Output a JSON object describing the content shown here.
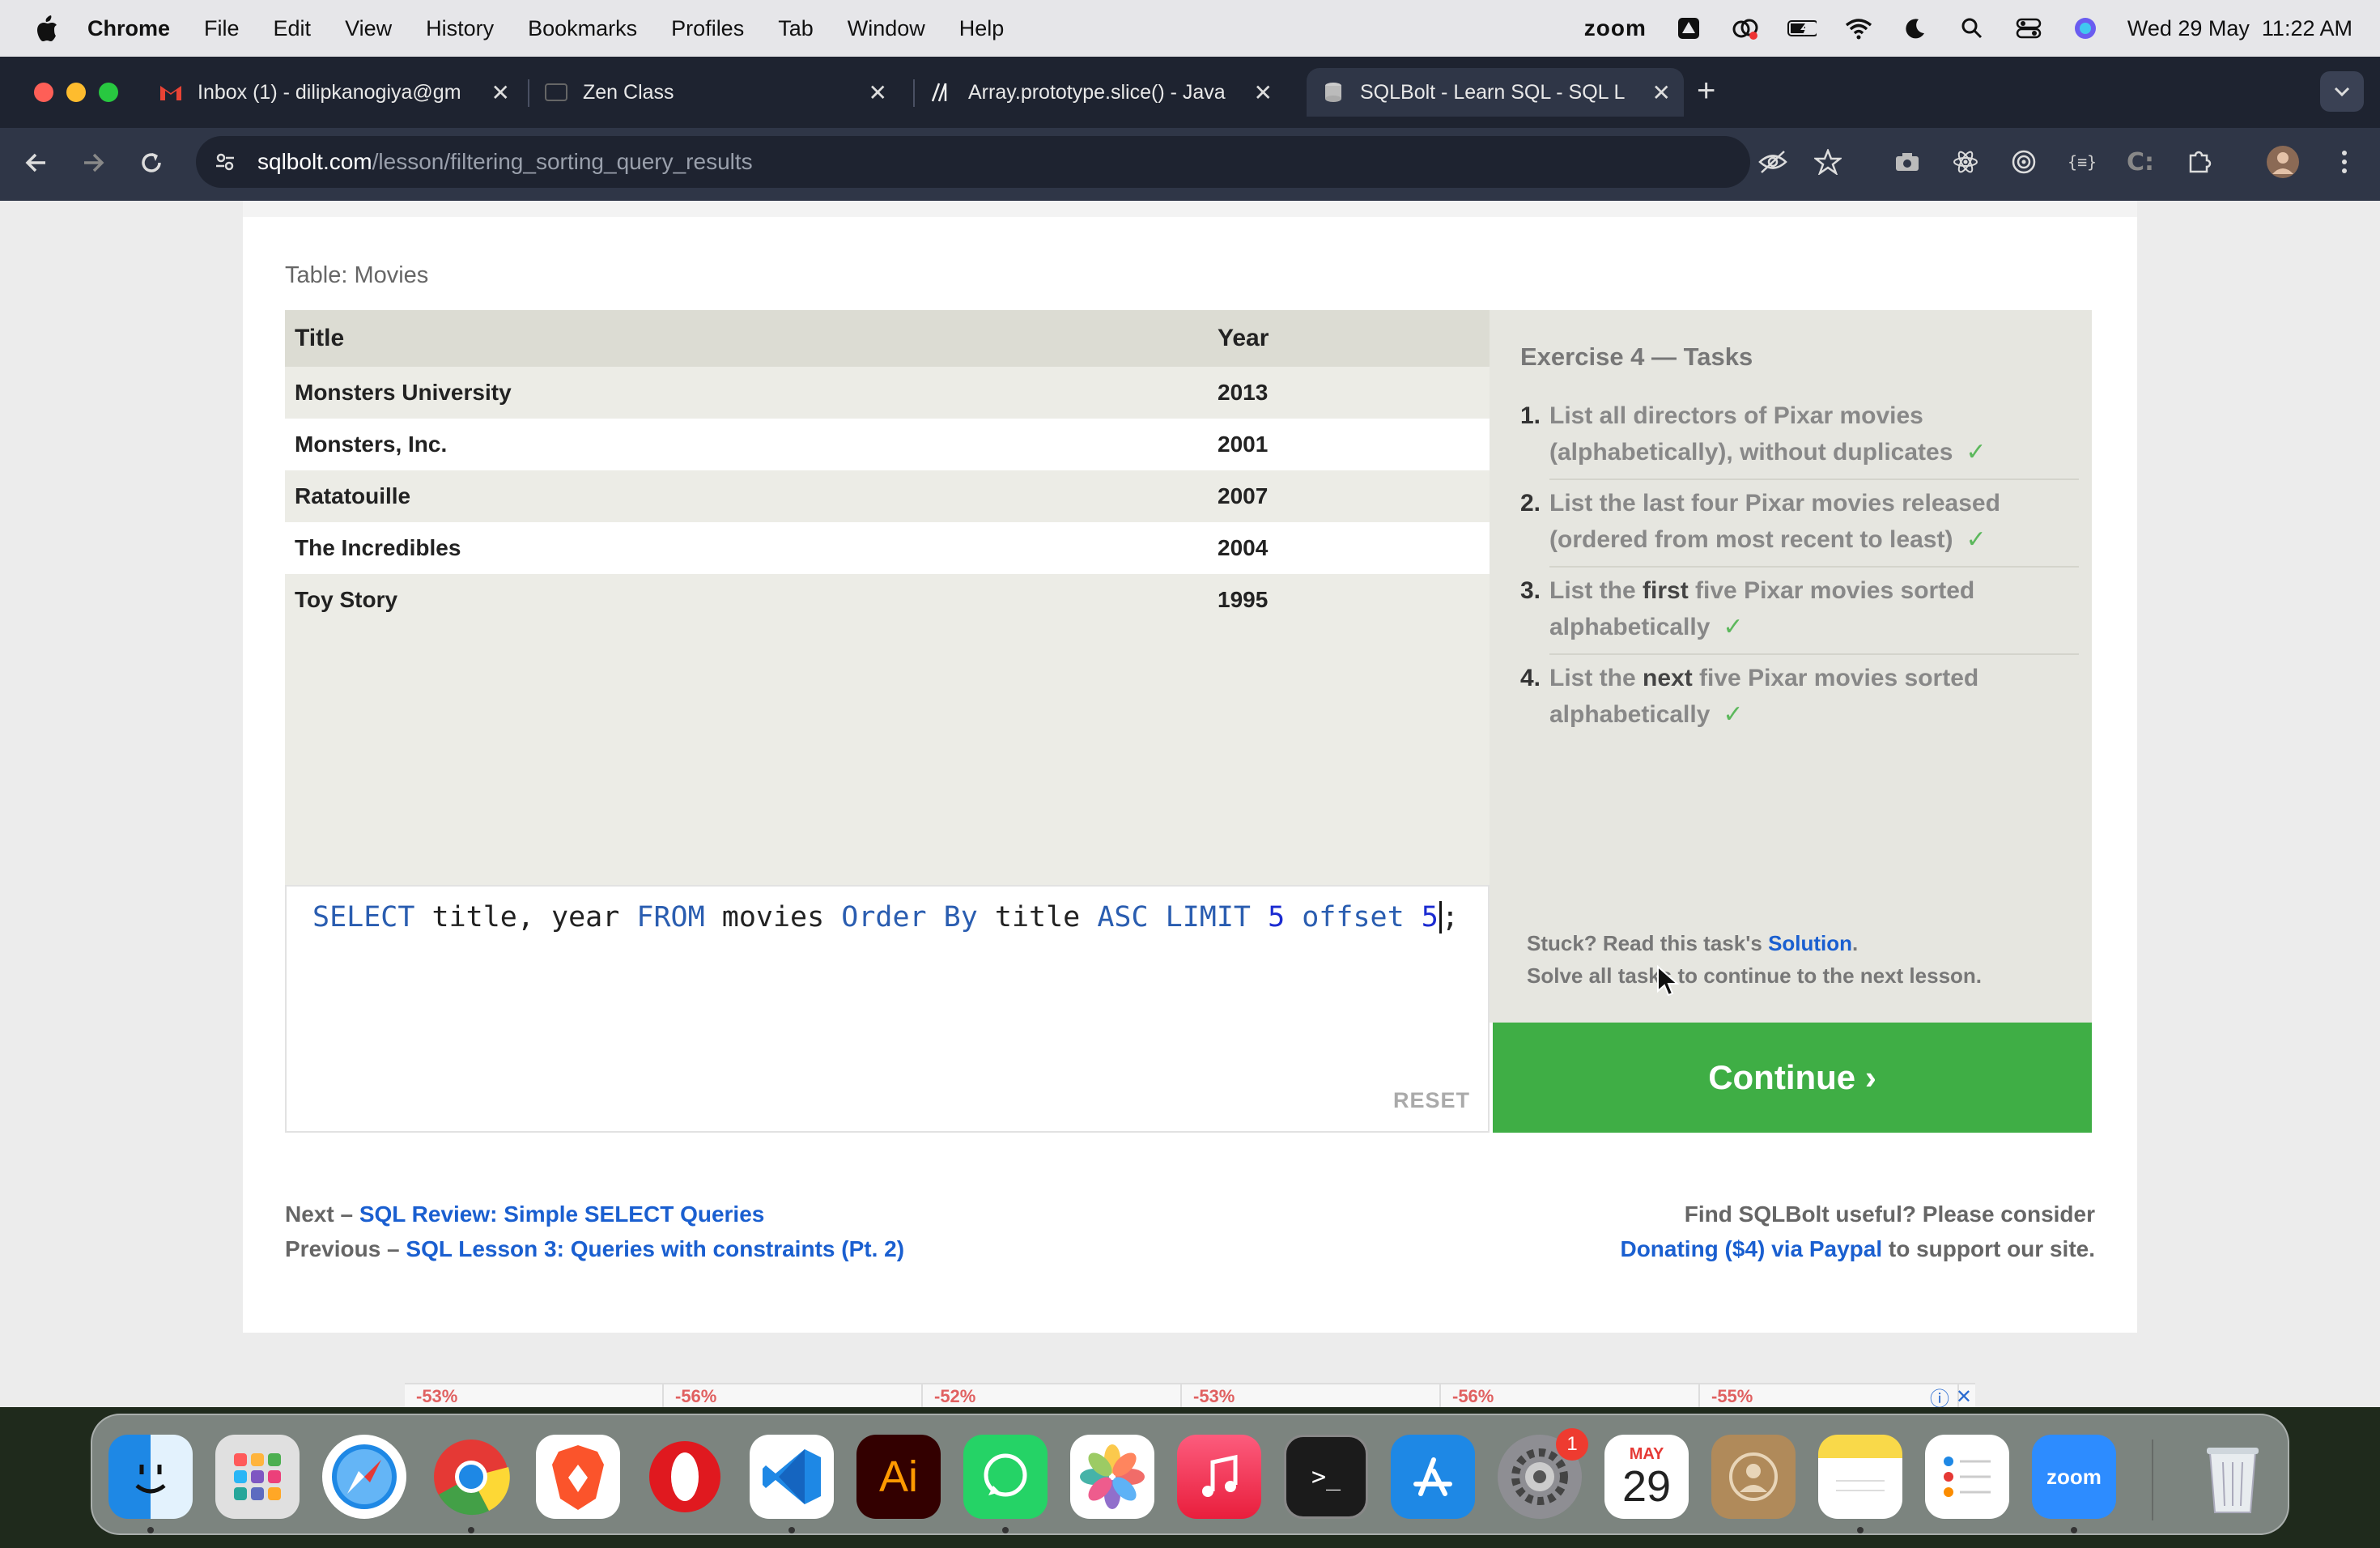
{
  "menubar": {
    "app": "Chrome",
    "menus": [
      "File",
      "Edit",
      "View",
      "History",
      "Bookmarks",
      "Profiles",
      "Tab",
      "Window",
      "Help"
    ],
    "zoom": "zoom",
    "datetime": "Wed 29 May  11:22 AM"
  },
  "tabs": [
    {
      "title": "Inbox (1) - dilipkanogiya@gm",
      "icon": "gmail-icon"
    },
    {
      "title": "Zen Class",
      "icon": "zen-icon"
    },
    {
      "title": "Array.prototype.slice() - Java",
      "icon": "mdn-icon"
    },
    {
      "title": "SQLBolt - Learn SQL - SQL L",
      "icon": "sqlbolt-icon",
      "active": true
    }
  ],
  "address": {
    "host": "sqlbolt.com",
    "path": "/lesson/filtering_sorting_query_results"
  },
  "page": {
    "table_label": "Table: Movies",
    "columns": [
      "Title",
      "Year"
    ],
    "rows": [
      {
        "title": "Monsters University",
        "year": "2013"
      },
      {
        "title": "Monsters, Inc.",
        "year": "2001"
      },
      {
        "title": "Ratatouille",
        "year": "2007"
      },
      {
        "title": "The Incredibles",
        "year": "2004"
      },
      {
        "title": "Toy Story",
        "year": "1995"
      }
    ],
    "query": {
      "t1": "SELECT",
      "t2": " title, year ",
      "t3": "FROM",
      "t4": " movies ",
      "t5": "Order By",
      "t6": " title ",
      "t7": "ASC LIMIT",
      "t8": " ",
      "t9": "5",
      "t10": " ",
      "t11": "offset",
      "t12": " ",
      "t13": "5",
      "t14": ";"
    },
    "reset": "RESET",
    "exercise_heading": "Exercise 4 — Tasks",
    "tasks": [
      {
        "num": "1.",
        "a": "List all directors of Pixar movies (alphabetically), without duplicates",
        "check": "✓"
      },
      {
        "num": "2.",
        "a": "List the last four Pixar movies released (ordered from most recent to least)",
        "check": "✓"
      },
      {
        "num": "3.",
        "pre": "List the ",
        "em": "first",
        "post": " five Pixar movies sorted alphabetically",
        "check": "✓"
      },
      {
        "num": "4.",
        "pre": "List the ",
        "em": "next",
        "post": " five Pixar movies sorted alphabetically",
        "check": "✓"
      }
    ],
    "stuck_prefix": "Stuck? Read this task's ",
    "solution_link": "Solution",
    "stuck_suffix": ".",
    "solve_all": "Solve all tasks to continue to the next lesson.",
    "continue": "Continue ›",
    "next_prefix": "Next – ",
    "next_link": "SQL Review: Simple SELECT Queries",
    "prev_prefix": "Previous – ",
    "prev_link": "SQL Lesson 3: Queries with constraints (Pt. 2)",
    "useful_text": "Find SQLBolt useful? Please consider",
    "donate_link": "Donating ($4) via Paypal",
    "donate_suffix": " to support our site.",
    "ads": [
      "-53%",
      "-56%",
      "-52%",
      "-53%",
      "-56%",
      "-55%"
    ]
  },
  "dock": {
    "apps": [
      "finder-icon",
      "launchpad-icon",
      "safari-icon",
      "chrome-icon",
      "brave-icon",
      "opera-icon",
      "vscode-icon",
      "illustrator-icon",
      "whatsapp-icon",
      "photos-icon",
      "music-icon",
      "terminal-icon",
      "appstore-icon",
      "settings-icon",
      "calendar-icon",
      "contacts-icon",
      "notes-icon",
      "reminders-icon",
      "zoom-icon",
      "trash-icon"
    ],
    "settings_badge": "1",
    "calendar_month": "MAY",
    "calendar_day": "29",
    "illustrator_label": "Ai",
    "zoom_label": "zoom"
  }
}
